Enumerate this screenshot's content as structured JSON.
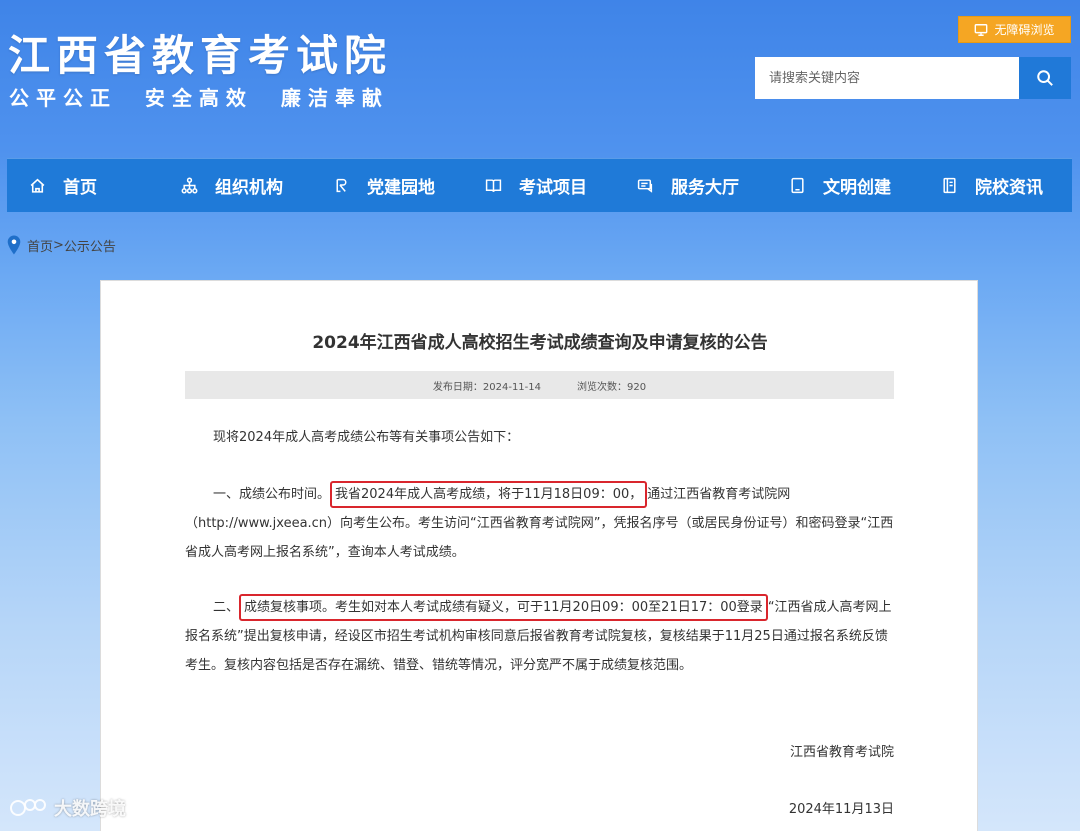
{
  "header": {
    "site_title": "江西省教育考试院",
    "slogan": "公平公正  安全高效  廉洁奉献",
    "accessibility_label": "无障碍浏览",
    "search": {
      "placeholder": "请搜索关键内容",
      "value": ""
    }
  },
  "nav": {
    "items": [
      {
        "label": "首页",
        "icon": "home-icon"
      },
      {
        "label": "组织机构",
        "icon": "org-chart-icon"
      },
      {
        "label": "党建园地",
        "icon": "party-icon"
      },
      {
        "label": "考试项目",
        "icon": "book-icon"
      },
      {
        "label": "服务大厅",
        "icon": "service-icon"
      },
      {
        "label": "文明创建",
        "icon": "tablet-icon"
      },
      {
        "label": "院校资讯",
        "icon": "document-icon"
      }
    ]
  },
  "breadcrumb": {
    "home": "首页",
    "separator": ">",
    "current": "公示公告"
  },
  "article": {
    "title": "2024年江西省成人高校招生考试成绩查询及申请复核的公告",
    "publish_label": "发布日期：",
    "publish_date": "2024-11-14",
    "views_label": "浏览次数：",
    "views": "920",
    "intro": "现将2024年成人高考成绩公布等有关事项公告如下：",
    "p1_prefix": "一、成绩公布时间。",
    "p1_highlight": "我省2024年成人高考成绩，将于11月18日09：00，",
    "p1_rest": "通过江西省教育考试院网（http://www.jxeea.cn）向考生公布。考生访问“江西省教育考试院网”，凭报名序号（或居民身份证号）和密码登录“江西省成人高考网上报名系统”，查询本人考试成绩。",
    "p2_prefix": "二、",
    "p2_highlight": "成绩复核事项。考生如对本人考试成绩有疑义，可于11月20日09：00至21日17：00登录",
    "p2_rest": "“江西省成人高考网上报名系统”提出复核申请，经设区市招生考试机构审核同意后报省教育考试院复核，复核结果于11月25日通过报名系统反馈考生。复核内容包括是否存在漏统、错登、错统等情况，评分宽严不属于成绩复核范围。",
    "signature": "江西省教育考试院",
    "sign_date": "2024年11月13日"
  },
  "watermark": "大数跨境",
  "colors": {
    "nav_bg": "#1f7ad8",
    "accent_orange": "#f5a623",
    "highlight_red": "#d9262d"
  }
}
